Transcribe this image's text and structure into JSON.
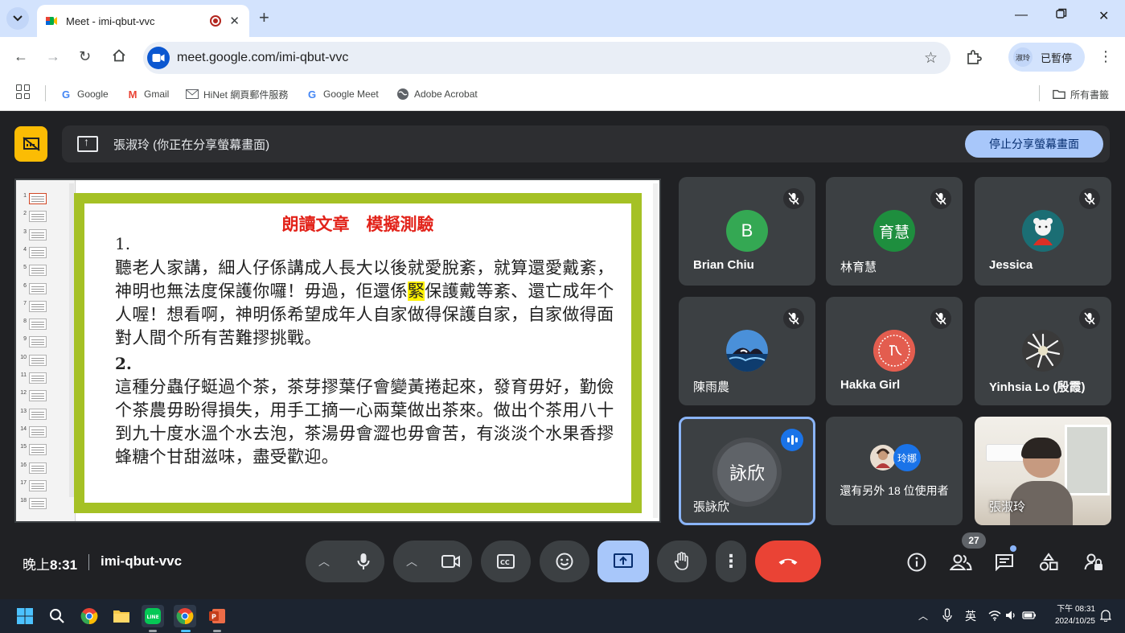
{
  "browser": {
    "tab_title": "Meet - imi-qbut-vvc",
    "url": "meet.google.com/imi-qbut-vvc",
    "profile_avatar": "淑玲",
    "profile_status": "已暫停",
    "bookmarks": [
      {
        "label": "Google",
        "icon": "google-icon"
      },
      {
        "label": "Gmail",
        "icon": "gmail-icon"
      },
      {
        "label": "HiNet 網頁郵件服務",
        "icon": "mail-icon"
      },
      {
        "label": "Google Meet",
        "icon": "google-icon"
      },
      {
        "label": "Adobe Acrobat",
        "icon": "globe-icon"
      }
    ],
    "all_bookmarks": "所有書籤"
  },
  "meet": {
    "presenter_banner": "張淑玲 (你正在分享螢幕畫面)",
    "stop_sharing": "停止分享螢幕畫面",
    "slide": {
      "title": "朗讀文章　模擬測驗",
      "para1_num": "1.",
      "para1_before": "聽老人家講，細人仔係講成人長大以後就愛脫紊，就算還愛戴紊，神明也無法度保護你囉！毋過，佢還係",
      "para1_highlight": "緊",
      "para1_after": "保護戴等紊、還亡成年个人喔！想看啊，神明係希望成年人自家做得保護自家，自家做得面對人間个所有苦難摎挑戰。",
      "para2_num": "2.",
      "para2": "這種分蟲仔蜓過个茶，茶芽摎葉仔會變黃捲起來，發育毋好，勤儉个茶農毋盼得損失，用手工摘一心兩葉做出茶來。做出个茶用八十到九十度水溫个水去泡，茶湯毋會澀也毋會苦，有淡淡个水果香摎蜂糖个甘甜滋味，盡受歡迎。",
      "thumb_numbers": [
        "1",
        "2",
        "3",
        "4",
        "5",
        "6",
        "7",
        "8",
        "9",
        "10",
        "11",
        "12",
        "13",
        "14",
        "15",
        "16",
        "17",
        "18"
      ]
    },
    "participants": [
      {
        "name": "Brian Chiu",
        "initial": "B",
        "avatar_color": "#34a853",
        "muted": true
      },
      {
        "name": "林育慧",
        "initial": "育慧",
        "avatar_color": "#1e8e3e",
        "muted": true
      },
      {
        "name": "Jessica",
        "avatar_color": "#1b6e74",
        "muted": true
      },
      {
        "name": "陳雨農",
        "avatar_color": "#2a6fb5",
        "muted": true
      },
      {
        "name": "Hakka Girl",
        "avatar_color": "#e35d4f",
        "muted": true
      },
      {
        "name": "Yinhsia Lo (殷霞)",
        "avatar_color": "#8c8c8c",
        "muted": true
      }
    ],
    "active_speaker": {
      "name": "張詠欣",
      "initial": "詠欣"
    },
    "others": {
      "text": "還有另外 18 位使用者",
      "avatar_label": "玲娜"
    },
    "self": {
      "name": "張淑玲"
    },
    "time_label": "晚上",
    "time": "8:31",
    "meeting_code": "imi-qbut-vvc",
    "people_count": "27"
  },
  "taskbar": {
    "ime": "英",
    "clock_time": "下午 08:31",
    "clock_date": "2024/10/25"
  },
  "colors": {
    "meet_bg": "#202124",
    "tile_bg": "#3c4043",
    "present_blue": "#a8c7fa",
    "leave_red": "#ea4335",
    "slide_green": "#a5c125",
    "slide_title_red": "#e2231a"
  }
}
